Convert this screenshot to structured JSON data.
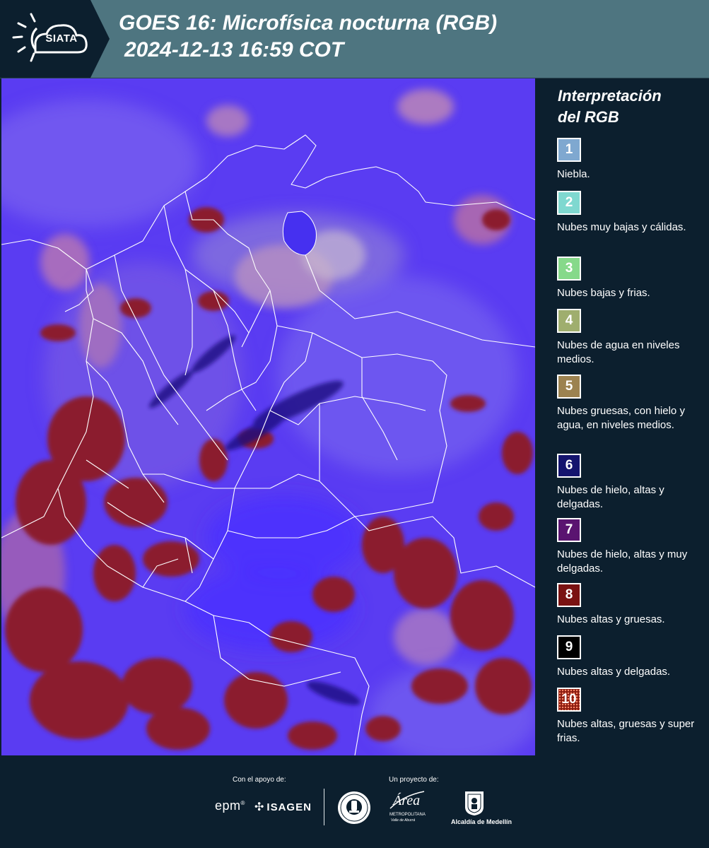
{
  "header": {
    "logo_text": "SIATA",
    "title_line1": "GOES 16: Microfísica nocturna (RGB)",
    "title_line2": "2024-12-13 16:59 COT",
    "background_color": "#4e7580"
  },
  "legend": {
    "title_line1": "Interpretación",
    "title_line2": "del RGB",
    "items": [
      {
        "number": "1",
        "label": "Niebla.",
        "color": "#7fa8d0",
        "text_color": "#ffffff"
      },
      {
        "number": "2",
        "label": "Nubes muy bajas y cálidas.",
        "color": "#7fd8d0",
        "text_color": "#ffffff"
      },
      {
        "number": "3",
        "label": "Nubes bajas y frias.",
        "color": "#86d98a",
        "text_color": "#ffffff"
      },
      {
        "number": "4",
        "label": "Nubes de agua en niveles medios.",
        "color": "#9fae6e",
        "text_color": "#ffffff"
      },
      {
        "number": "5",
        "label": "Nubes gruesas, con hielo y agua, en niveles medios.",
        "color": "#9c8250",
        "text_color": "#ffffff"
      },
      {
        "number": "6",
        "label": "Nubes de hielo, altas y delgadas.",
        "color": "#14146e",
        "text_color": "#ffffff"
      },
      {
        "number": "7",
        "label": "Nubes de hielo, altas y muy delgadas.",
        "color": "#5a1470",
        "text_color": "#ffffff"
      },
      {
        "number": "8",
        "label": "Nubes altas y gruesas.",
        "color": "#7a1212",
        "text_color": "#ffffff"
      },
      {
        "number": "9",
        "label": "Nubes altas y delgadas.",
        "color": "#000000",
        "text_color": "#ffffff"
      },
      {
        "number": "10",
        "label": "Nubes altas, gruesas y super frias.",
        "color": "#8a1c10",
        "text_color": "#ffffff"
      }
    ]
  },
  "map": {
    "background_color": "#5a3cf2",
    "thick_cloud_color": "#8b1a2e",
    "border_color": "#ffffff"
  },
  "footer": {
    "support_label": "Con el apoyo de:",
    "project_label": "Un proyecto de:",
    "epm_text": "epm",
    "epm_mark": "®",
    "isagen_text": "ISAGEN",
    "area_main": "Área",
    "area_sub1": "METROPOLITANA",
    "area_sub2": "Valle de Aburrá",
    "medellin_text": "Alcaldía de Medellín"
  }
}
